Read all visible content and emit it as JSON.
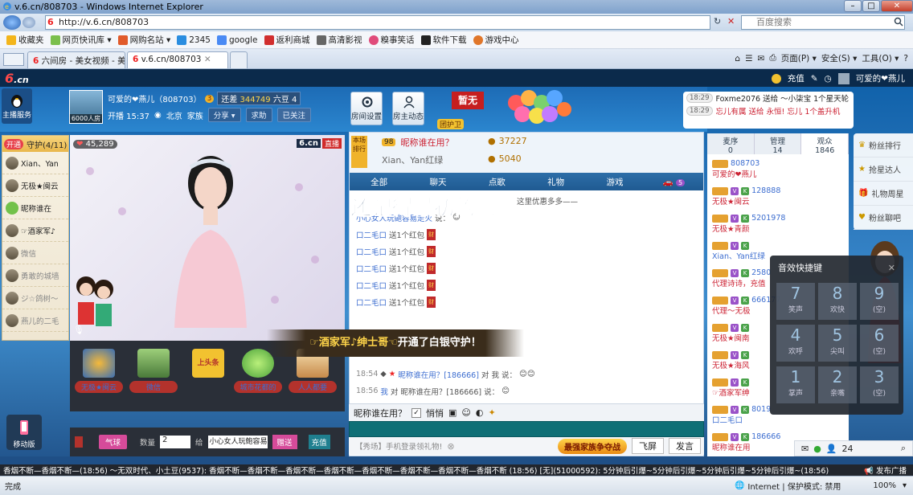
{
  "browser": {
    "title": "v.6.cn/808703 - Windows Internet Explorer",
    "url": "http://v.6.cn/808703",
    "search_placeholder": "百度搜索",
    "favorites": [
      "收藏夹",
      "网页快讯库 ▾",
      "网购名站 ▾",
      "2345",
      "google",
      "返利商城",
      "高清影视",
      "糗事笑话",
      "软件下载",
      "游戏中心"
    ],
    "tabs": [
      "六间房 - 美女视频 - 美女...",
      "v.6.cn/808703"
    ],
    "commands": [
      "页面(P) ▾",
      "安全(S) ▾",
      "工具(O) ▾"
    ],
    "status_left": "完成",
    "status_zone": "Internet | 保护模式: 禁用",
    "zoom": "100%"
  },
  "site": {
    "logo": "6",
    "logo_suffix": ".cn",
    "topnav_recharge": "充值",
    "topnav_user": "可爱的❤燕儿",
    "service_label": "主播服务",
    "host": {
      "name": "可爱的❤燕儿（808703）",
      "badge": "3",
      "viewers_label": "6000人房",
      "progress_prefix": "还差",
      "progress_value": "344749",
      "progress_unit": "六豆",
      "progress_level": "4",
      "start_time": "开播 15:37",
      "location": "北京",
      "family": "家族",
      "share": "分享 ▾",
      "ask": "求助",
      "followed": "已关注"
    },
    "room_settings": "房间设置",
    "host_dynamic": "房主动态",
    "guard_badge": "暂无",
    "guard_team": "团护卫",
    "notices": [
      {
        "time": "18:29",
        "text": "Foxme2076 送给 〜小柒宝 1个星天轮"
      },
      {
        "time": "18:29",
        "text": "忘儿有属 送给 永恒! 忘儿 1个盖升机"
      }
    ],
    "guards": {
      "open_label": "开通",
      "title": "守护(4/11)",
      "items": [
        "Xian、Yan",
        "无极★闽云",
        "昵称谁在",
        "☞酒家军♪",
        "微信",
        "勇敢的城墙",
        "ジ☆鸽树〜",
        "燕儿的二毛"
      ]
    },
    "video": {
      "fans": "45,289",
      "brand": "6.cn",
      "live": "直播"
    },
    "gifts": [
      "无极★闽云",
      "微信",
      "上头条",
      "城市花都的",
      "人人都要"
    ],
    "send": {
      "gift_type": "气球",
      "qty_label": "数量",
      "qty": "2",
      "to_label": "给",
      "to_user": "小心女人玩鲍容易",
      "send_btn": "赠送",
      "recharge": "充值"
    },
    "mobile_label": "移动版",
    "banner": {
      "prefix": "☞酒家军♪绅士哥☜",
      "text": "开通了白银守护！"
    },
    "chat": {
      "top_user_badge": "98",
      "top_user": "昵称谁在用？",
      "top_beans": "37227",
      "second_user": "Xian、Yan红绿",
      "second_beans": "5040",
      "tabs": [
        "全部",
        "聊天",
        "点歌",
        "礼物",
        "游戏",
        "5"
      ],
      "slogan": "还记得最初的吻",
      "notice_line": "这里优惠多多——",
      "lines": [
        {
          "time": "",
          "name": "小心女人玩鲍容易走火",
          "text": "说："
        },
        {
          "time": "",
          "name": "口二毛口",
          "text": "送1个红包"
        },
        {
          "time": "",
          "name": "口二毛口",
          "text": "送1个红包"
        },
        {
          "time": "",
          "name": "口二毛口",
          "text": "送1个红包"
        },
        {
          "time": "",
          "name": "口二毛口",
          "text": "送1个红包"
        },
        {
          "time": "",
          "name": "口二毛口",
          "text": "送1个红包"
        }
      ],
      "line_a_time": "18:54",
      "line_a_name": "昵称谁在用？[186666]",
      "line_a_text": "对 我 说：",
      "line_b_time": "18:56",
      "line_b_me": "我",
      "line_b_text": "对 昵称谁在用？[186666] 说：",
      "private_to": "昵称谁在用？",
      "private_label": "悄悄",
      "foot_tip": "【秀场】手机登录领礼物!",
      "battle": "最强家族争夺战",
      "fly": "飞屏",
      "send": "发言"
    },
    "users": {
      "tabs": [
        {
          "label": "麦序",
          "count": "0"
        },
        {
          "label": "管理",
          "count": "14"
        },
        {
          "label": "观众",
          "count": "1846"
        }
      ],
      "items": [
        {
          "id": "808703",
          "name": "可爱的❤燕儿"
        },
        {
          "id": "128888",
          "name": "无极★闽云"
        },
        {
          "id": "5201978",
          "name": "无极★青颜"
        },
        {
          "id": "",
          "name": "Xian、Yan红绿"
        },
        {
          "id": "2580",
          "name": "代理诗诗，充值"
        },
        {
          "id": "666177",
          "name": "代理〜无极"
        },
        {
          "id": "",
          "name": "无极★闽南"
        },
        {
          "id": "",
          "name": "无极★海风"
        },
        {
          "id": "",
          "name": "☞酒家军绅"
        },
        {
          "id": "8019",
          "name": "口二毛口"
        },
        {
          "id": "186666",
          "name": "昵称谁在用"
        }
      ],
      "count_online": "24"
    },
    "rightnav": [
      "粉丝排行",
      "抢星达人",
      "礼物周星",
      "粉丝聊吧"
    ],
    "hotkeys": {
      "title": "音效快捷键",
      "keys": [
        {
          "n": "7",
          "t": "笑声"
        },
        {
          "n": "8",
          "t": "欢快"
        },
        {
          "n": "9",
          "t": "(空)"
        },
        {
          "n": "4",
          "t": "欢呼"
        },
        {
          "n": "5",
          "t": "尖叫"
        },
        {
          "n": "6",
          "t": "(空)"
        },
        {
          "n": "1",
          "t": "掌声"
        },
        {
          "n": "2",
          "t": "亲嘴"
        },
        {
          "n": "3",
          "t": "(空)"
        }
      ]
    },
    "marquee": "香烟不断—香烟不断—(18:56)  〜无双时代、小土豆(9537): 香烟不断—香烟不断—香烟不断—香烟不断—香烟不断—香烟不断—香烟不断—香烟不断 (18:56)  [无](51000592): 5分钟后引爆~5分钟后引爆~5分钟后引爆~5分钟后引爆~(18:56)",
    "publish_broadcast": "发布广播"
  }
}
